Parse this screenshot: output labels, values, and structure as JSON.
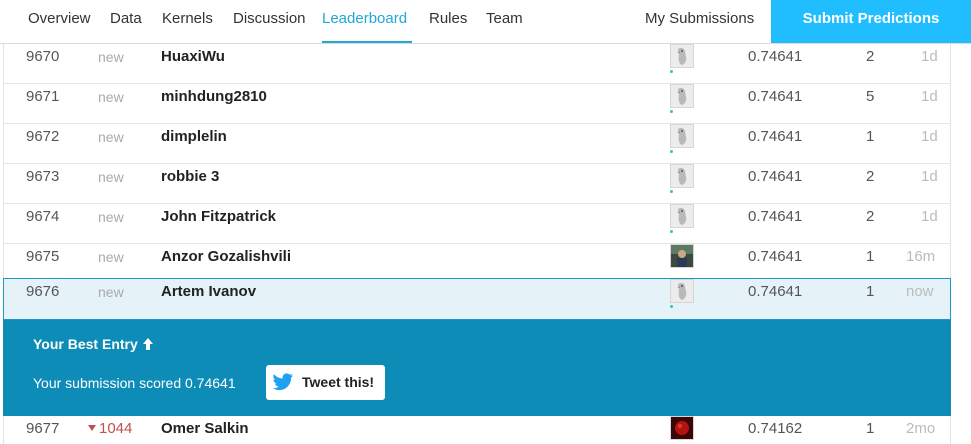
{
  "nav": {
    "tabs": [
      {
        "label": "Overview",
        "active": false
      },
      {
        "label": "Data",
        "active": false
      },
      {
        "label": "Kernels",
        "active": false
      },
      {
        "label": "Discussion",
        "active": false
      },
      {
        "label": "Leaderboard",
        "active": true
      },
      {
        "label": "Rules",
        "active": false
      },
      {
        "label": "Team",
        "active": false
      }
    ],
    "my_submissions": "My Submissions",
    "submit": "Submit Predictions"
  },
  "leaderboard": {
    "rows": [
      {
        "rank": "9670",
        "change": "new",
        "team": "HuaxiWu",
        "score": "0.74641",
        "entries": "2",
        "last": "1d",
        "avatar": "default-penguin"
      },
      {
        "rank": "9671",
        "change": "new",
        "team": "minhdung2810",
        "score": "0.74641",
        "entries": "5",
        "last": "1d",
        "avatar": "default-penguin"
      },
      {
        "rank": "9672",
        "change": "new",
        "team": "dimplelin",
        "score": "0.74641",
        "entries": "1",
        "last": "1d",
        "avatar": "default-penguin"
      },
      {
        "rank": "9673",
        "change": "new",
        "team": "robbie 3",
        "score": "0.74641",
        "entries": "2",
        "last": "1d",
        "avatar": "default-penguin"
      },
      {
        "rank": "9674",
        "change": "new",
        "team": "John Fitzpatrick",
        "score": "0.74641",
        "entries": "2",
        "last": "1d",
        "avatar": "default-penguin"
      },
      {
        "rank": "9675",
        "change": "new",
        "team": "Anzor Gozalishvili",
        "score": "0.74641",
        "entries": "1",
        "last": "16m",
        "avatar": "photo"
      },
      {
        "rank": "9676",
        "change": "new",
        "team": "Artem Ivanov",
        "score": "0.74641",
        "entries": "1",
        "last": "now",
        "avatar": "default-penguin",
        "mine": true
      }
    ],
    "after_row": {
      "rank": "9677",
      "change": "1044",
      "change_dir": "down",
      "team": "Omer Salkin",
      "score": "0.74162",
      "entries": "1",
      "last": "2mo",
      "avatar": "red-photo"
    }
  },
  "best_entry": {
    "title": "Your Best Entry",
    "message": "Your submission scored 0.74641",
    "tweet_label": "Tweet this!",
    "icon": "up-arrow-icon",
    "tweet_icon": "twitter-bird-icon"
  },
  "colors": {
    "accent": "#20a8d8",
    "submit_bg": "#20beff",
    "banner_bg": "#0e8cb8",
    "highlight_row": "#e5f2f8",
    "rank_drop": "#c0504d",
    "online_dot": "#33c9a1"
  }
}
